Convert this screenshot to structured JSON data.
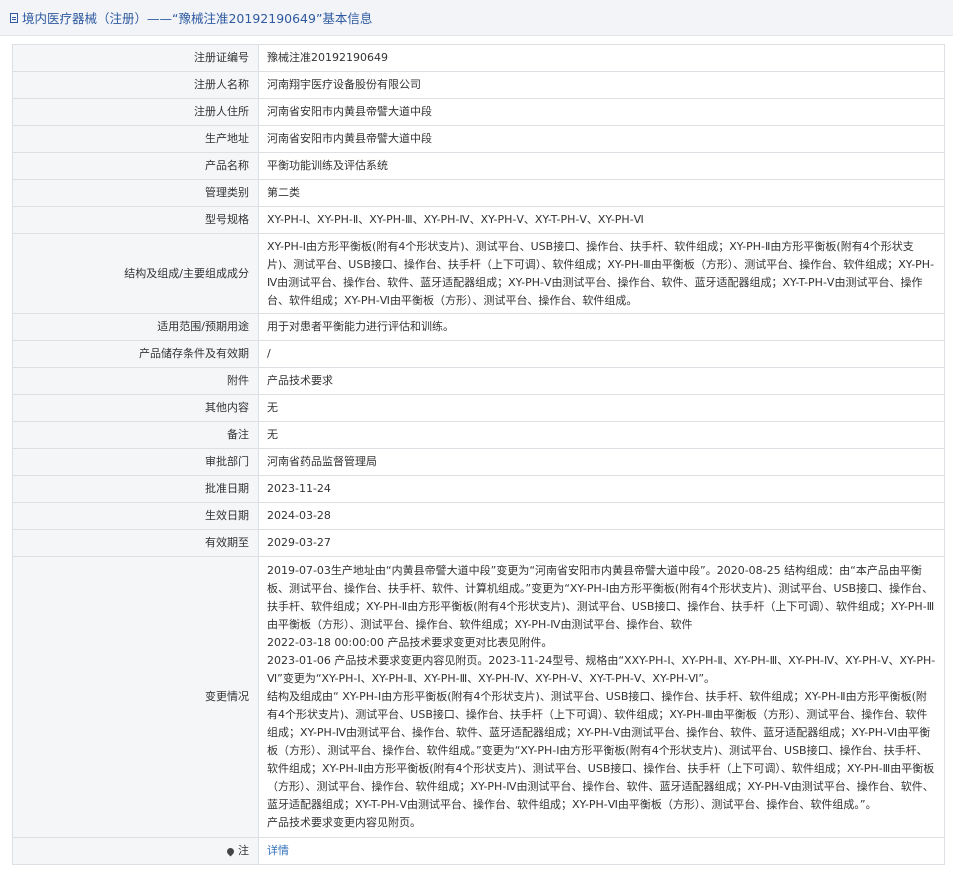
{
  "header": {
    "title": "境内医疗器械（注册）——“豫械注准20192190649”基本信息"
  },
  "rows": [
    {
      "label": "注册证编号",
      "value": "豫械注准20192190649"
    },
    {
      "label": "注册人名称",
      "value": "河南翔宇医疗设备股份有限公司"
    },
    {
      "label": "注册人住所",
      "value": "河南省安阳市内黄县帝譬大道中段"
    },
    {
      "label": "生产地址",
      "value": "河南省安阳市内黄县帝譬大道中段"
    },
    {
      "label": "产品名称",
      "value": "平衡功能训练及评估系统"
    },
    {
      "label": "管理类别",
      "value": "第二类"
    },
    {
      "label": "型号规格",
      "value": "XY-PH-Ⅰ、XY-PH-Ⅱ、XY-PH-Ⅲ、XY-PH-Ⅳ、XY-PH-Ⅴ、XY-T-PH-Ⅴ、XY-PH-Ⅵ"
    },
    {
      "label": "结构及组成/主要组成成分",
      "value": "XY-PH-Ⅰ由方形平衡板(附有4个形状支片)、测试平台、USB接口、操作台、扶手杆、软件组成；XY-PH-Ⅱ由方形平衡板(附有4个形状支片)、测试平台、USB接口、操作台、扶手杆（上下可调）、软件组成；XY-PH-Ⅲ由平衡板（方形）、测试平台、操作台、软件组成；XY-PH-Ⅳ由测试平台、操作台、软件、蓝牙适配器组成；XY-PH-Ⅴ由测试平台、操作台、软件、蓝牙适配器组成；XY-T-PH-Ⅴ由测试平台、操作台、软件组成；XY-PH-Ⅵ由平衡板（方形）、测试平台、操作台、软件组成。"
    },
    {
      "label": "适用范围/预期用途",
      "value": "用于对患者平衡能力进行评估和训练。"
    },
    {
      "label": "产品储存条件及有效期",
      "value": "/"
    },
    {
      "label": "附件",
      "value": "产品技术要求"
    },
    {
      "label": "其他内容",
      "value": "无"
    },
    {
      "label": "备注",
      "value": "无"
    },
    {
      "label": "审批部门",
      "value": "河南省药品监督管理局"
    },
    {
      "label": "批准日期",
      "value": "2023-11-24"
    },
    {
      "label": "生效日期",
      "value": "2024-03-28"
    },
    {
      "label": "有效期至",
      "value": "2029-03-27"
    }
  ],
  "changes": {
    "label": "变更情况",
    "lines": [
      "2019-07-03生产地址由“内黄县帝譬大道中段”变更为“河南省安阳市内黄县帝譬大道中段”。2020-08-25 结构组成：由“本产品由平衡板、测试平台、操作台、扶手杆、软件、计算机组成。”变更为“XY-PH-Ⅰ由方形平衡板(附有4个形状支片)、测试平台、USB接口、操作台、扶手杆、软件组成；XY-PH-Ⅱ由方形平衡板(附有4个形状支片)、测试平台、USB接口、操作台、扶手杆（上下可调）、软件组成；XY-PH-Ⅲ由平衡板（方形）、测试平台、操作台、软件组成；XY-PH-Ⅳ由测试平台、操作台、软件",
      "2022-03-18 00:00:00 产品技术要求变更对比表见附件。",
      "2023-01-06 产品技术要求变更内容见附页。2023-11-24型号、规格由“XXY-PH-Ⅰ、XY-PH-Ⅱ、XY-PH-Ⅲ、XY-PH-Ⅳ、XY-PH-Ⅴ、XY-PH-Ⅵ”变更为“XY-PH-Ⅰ、XY-PH-Ⅱ、XY-PH-Ⅲ、XY-PH-Ⅳ、XY-PH-Ⅴ、XY-T-PH-Ⅴ、XY-PH-Ⅵ”。",
      "结构及组成由“ XY-PH-Ⅰ由方形平衡板(附有4个形状支片)、测试平台、USB接口、操作台、扶手杆、软件组成；XY-PH-Ⅱ由方形平衡板(附有4个形状支片)、测试平台、USB接口、操作台、扶手杆（上下可调）、软件组成；XY-PH-Ⅲ由平衡板（方形）、测试平台、操作台、软件组成；XY-PH-Ⅳ由测试平台、操作台、软件、蓝牙适配器组成；XY-PH-Ⅴ由测试平台、操作台、软件、蓝牙适配器组成；XY-PH-Ⅵ由平衡板（方形）、测试平台、操作台、软件组成。”变更为“XY-PH-Ⅰ由方形平衡板(附有4个形状支片)、测试平台、USB接口、操作台、扶手杆、软件组成；XY-PH-Ⅱ由方形平衡板(附有4个形状支片)、测试平台、USB接口、操作台、扶手杆（上下可调）、软件组成；XY-PH-Ⅲ由平衡板（方形）、测试平台、操作台、软件组成；XY-PH-Ⅳ由测试平台、操作台、软件、蓝牙适配器组成；XY-PH-Ⅴ由测试平台、操作台、软件、蓝牙适配器组成；XY-T-PH-Ⅴ由测试平台、操作台、软件组成；XY-PH-Ⅵ由平衡板（方形）、测试平台、操作台、软件组成。”。",
      "产品技术要求变更内容见附页。"
    ]
  },
  "note": {
    "label": "注",
    "link_text": "详情",
    "icon": "location-pin-icon"
  }
}
